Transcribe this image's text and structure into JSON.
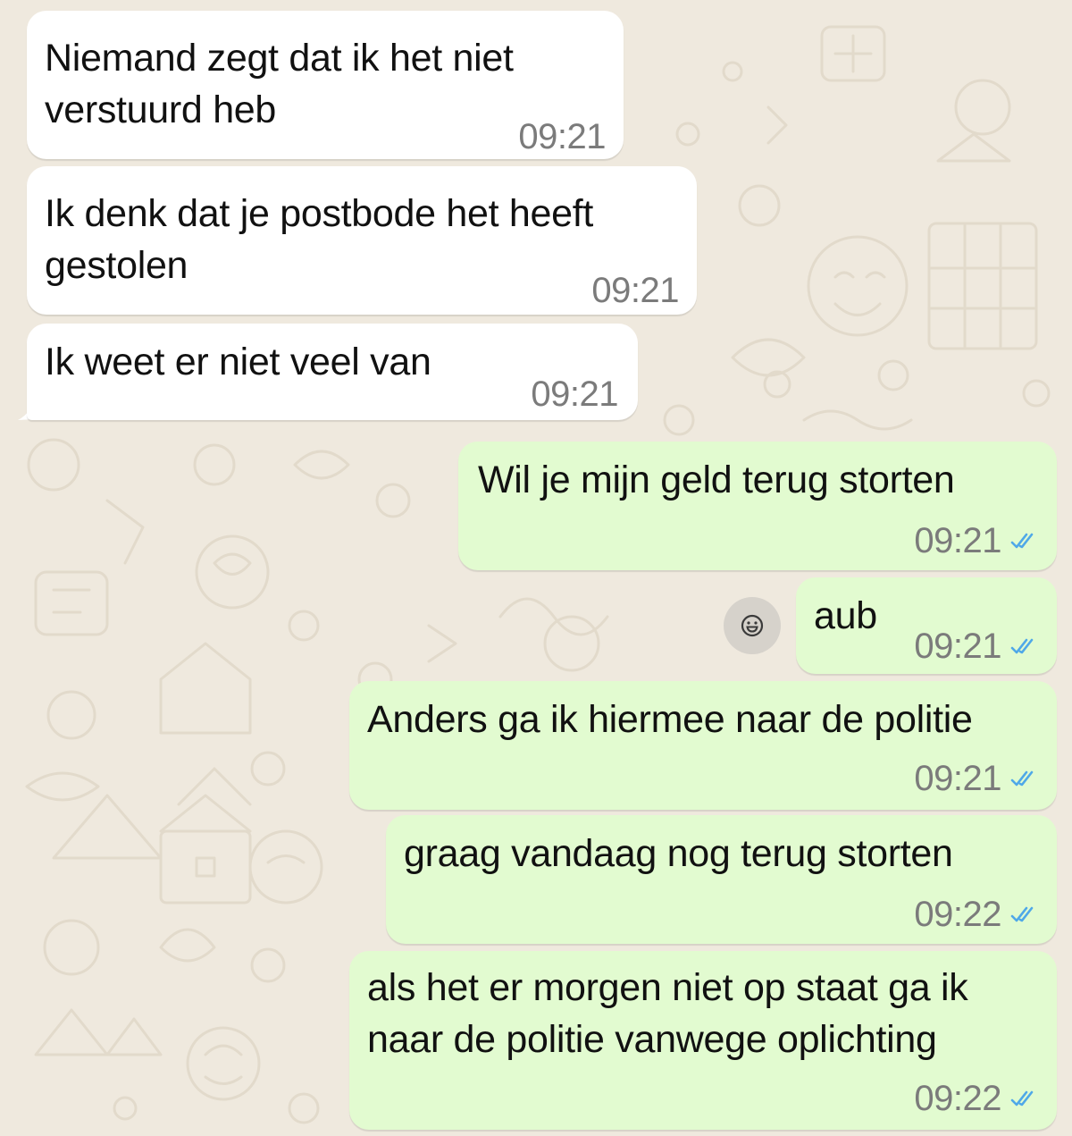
{
  "colors": {
    "background": "#efe9de",
    "incoming_bubble": "#ffffff",
    "outgoing_bubble": "#e2fbd0",
    "timestamp": "#7b7b7b",
    "read_ticks": "#4fa8e8"
  },
  "messages": [
    {
      "direction": "in",
      "text": "Niemand zegt dat ik het niet\nverstuurd heb",
      "time": "09:21"
    },
    {
      "direction": "in",
      "text": "Ik denk dat je postbode het heeft\ngestolen",
      "time": "09:21"
    },
    {
      "direction": "in",
      "text": "Ik weet er niet veel van",
      "time": "09:21"
    },
    {
      "direction": "out",
      "text": "Wil je mijn geld terug storten",
      "time": "09:21",
      "status": "read"
    },
    {
      "direction": "out",
      "text": "aub",
      "time": "09:21",
      "status": "read"
    },
    {
      "direction": "out",
      "text": "Anders ga ik hiermee naar de politie",
      "time": "09:21",
      "status": "read"
    },
    {
      "direction": "out",
      "text": "graag vandaag nog terug storten",
      "time": "09:22",
      "status": "read"
    },
    {
      "direction": "out",
      "text": "als het er morgen niet op staat ga ik\nnaar de politie vanwege oplichting",
      "time": "09:22",
      "status": "read"
    }
  ],
  "reaction_button": {
    "icon": "smiley-icon"
  }
}
